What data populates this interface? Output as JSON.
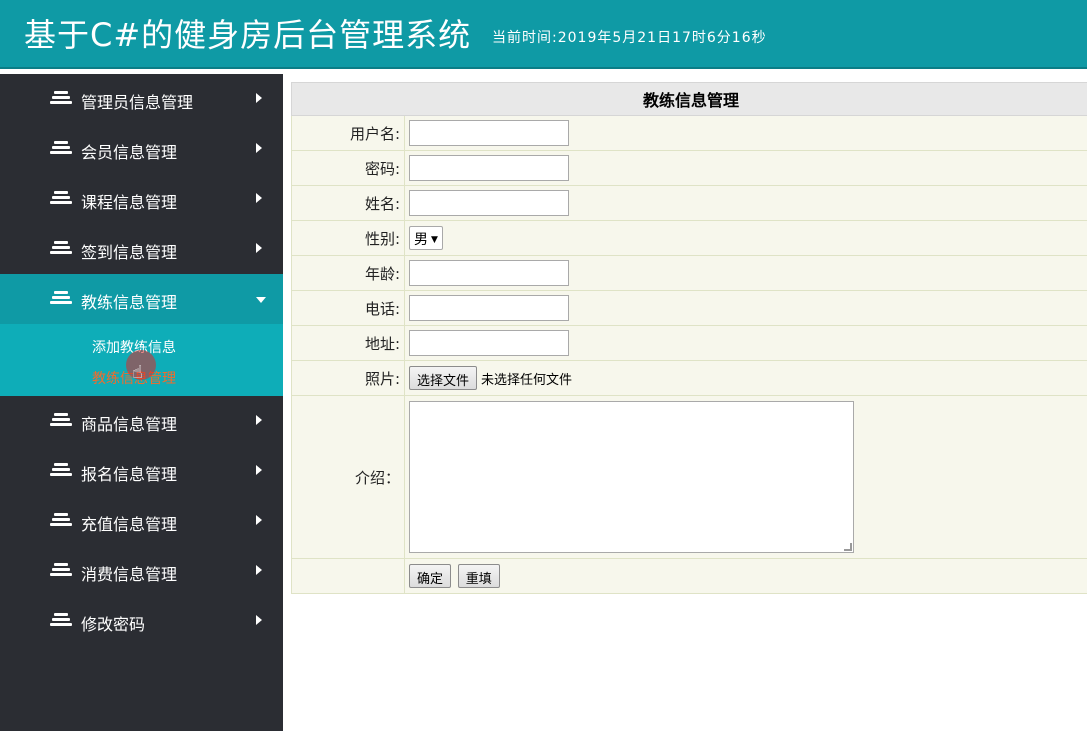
{
  "header": {
    "title": "基于C#的健身房后台管理系统",
    "time_text": "当前时间:2019年5月21日17时6分16秒"
  },
  "sidebar": {
    "items": [
      {
        "label": "管理员信息管理"
      },
      {
        "label": "会员信息管理"
      },
      {
        "label": "课程信息管理"
      },
      {
        "label": "签到信息管理"
      },
      {
        "label": "教练信息管理",
        "expanded": true,
        "sub": [
          "添加教练信息",
          "教练信息管理"
        ]
      },
      {
        "label": "商品信息管理"
      },
      {
        "label": "报名信息管理"
      },
      {
        "label": "充值信息管理"
      },
      {
        "label": "消费信息管理"
      },
      {
        "label": "修改密码"
      }
    ]
  },
  "form": {
    "title": "教练信息管理",
    "username_label": "用户名:",
    "password_label": "密码:",
    "name_label": "姓名:",
    "gender_label": "性别:",
    "gender_value": "男",
    "age_label": "年龄:",
    "phone_label": "电话:",
    "address_label": "地址:",
    "photo_label": "照片:",
    "photo_button": "选择文件",
    "photo_status": "未选择任何文件",
    "intro_label": "介绍：",
    "submit_label": "确定",
    "reset_label": "重填"
  },
  "colors": {
    "header_bg": "#0f9aa5",
    "sidebar_bg": "#2b2d33",
    "active_bg": "#0f9aa5",
    "submenu_bg": "#0eadb8",
    "active_sub_text": "#f36b2b"
  }
}
